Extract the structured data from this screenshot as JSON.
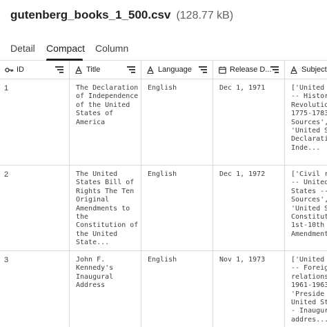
{
  "file": {
    "name": "gutenberg_books_1_500.csv",
    "size": "(128.77 kB)"
  },
  "tabs": [
    {
      "label": "Detail"
    },
    {
      "label": "Compact"
    },
    {
      "label": "Column"
    }
  ],
  "columns": [
    {
      "label": "ID"
    },
    {
      "label": "Title"
    },
    {
      "label": "Language"
    },
    {
      "label": "Release D..."
    },
    {
      "label": "Subjects"
    }
  ],
  "rows": [
    {
      "id": "1",
      "title": "The Declaration\nof Independence\nof the United\nStates of\nAmerica",
      "language": "English",
      "release": "Dec 1, 1971",
      "subjects": "['United\n-- Histor\nRevolutio\n1775-1783\nSources',\n'United S\nDeclarati\nInde..."
    },
    {
      "id": "2",
      "title": "The United\nStates Bill of\nRights The Ten\nOriginal\nAmendments to\nthe\nConstitution of\nthe United\nState...",
      "language": "English",
      "release": "Dec 1, 1972",
      "subjects": "['Civil r\n-- United\nStates --\nSources',\n'United S\nConstitut\n1st-10th\nAmendment"
    },
    {
      "id": "3",
      "title": "John F.\nKennedy's\nInaugural\nAddress",
      "language": "English",
      "release": "Nov 1, 1973",
      "subjects": "['United\n-- Foreig\nrelations\n1961-1963\n'Preside\nUnited St\n- Inaugur\naddres..."
    }
  ]
}
